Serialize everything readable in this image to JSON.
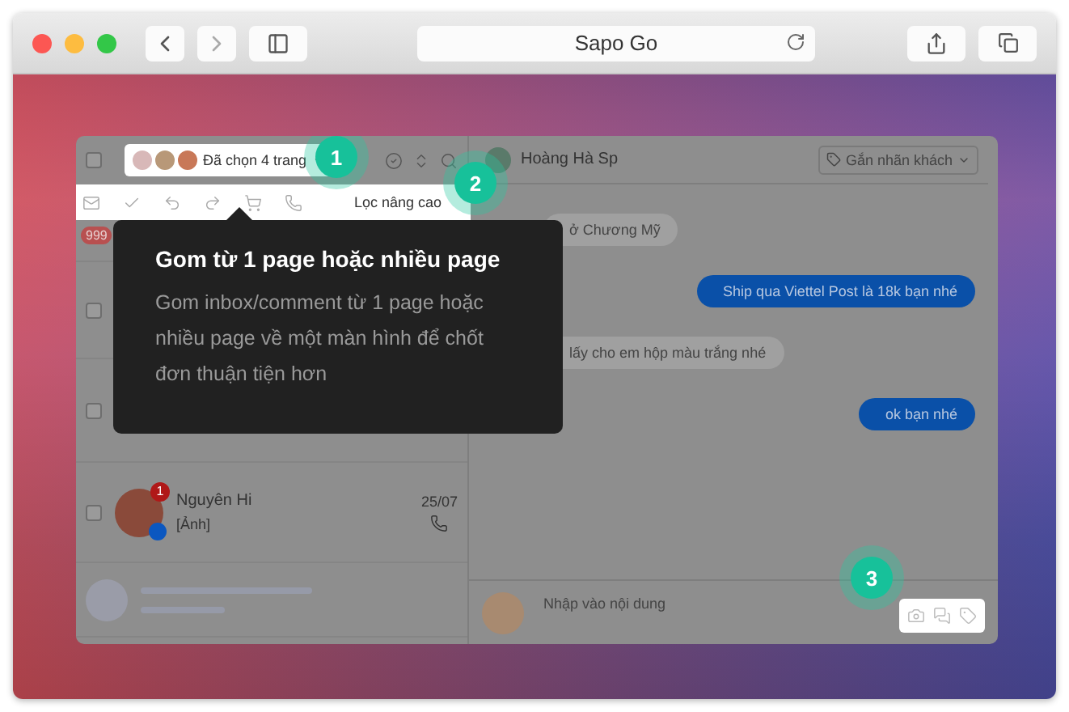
{
  "browser": {
    "title": "Sapo Go"
  },
  "app": {
    "select_all": {
      "checked": false
    },
    "page_selector": {
      "label": "Đã chọn 4 trang"
    },
    "filter_toolbar": {
      "link": "Lọc nâng cao"
    },
    "conversations": [
      {
        "kind": "unread",
        "badge": "999"
      },
      {
        "kind": "blank",
        "checked": false
      },
      {
        "kind": "blank",
        "checked": false
      },
      {
        "kind": "contact",
        "name": "Nguyên Hi",
        "preview": "[Ảnh]",
        "time": "25/07",
        "unread": "1",
        "checked": false
      },
      {
        "kind": "skeleton"
      }
    ],
    "chat": {
      "contact": "Hoàng Hà Sp",
      "tag_button": "Gắn nhãn khách",
      "messages": [
        {
          "text": "ở Chương Mỹ",
          "outgoing": false
        },
        {
          "text": "Ship qua Viettel Post là 18k bạn nhé",
          "outgoing": true
        },
        {
          "text": "lấy cho em hộp màu trắng nhé",
          "outgoing": false
        },
        {
          "text": "ok bạn nhé",
          "outgoing": true
        }
      ],
      "composer": {
        "placeholder": "Nhập vào nội dung"
      }
    }
  },
  "tooltip": {
    "title": "Gom từ 1 page hoặc nhiều page",
    "body": "Gom inbox/comment từ 1 page hoặc nhiều page về một màn hình để chốt đơn thuận tiện hơn"
  },
  "steps": [
    "1",
    "2",
    "3"
  ]
}
